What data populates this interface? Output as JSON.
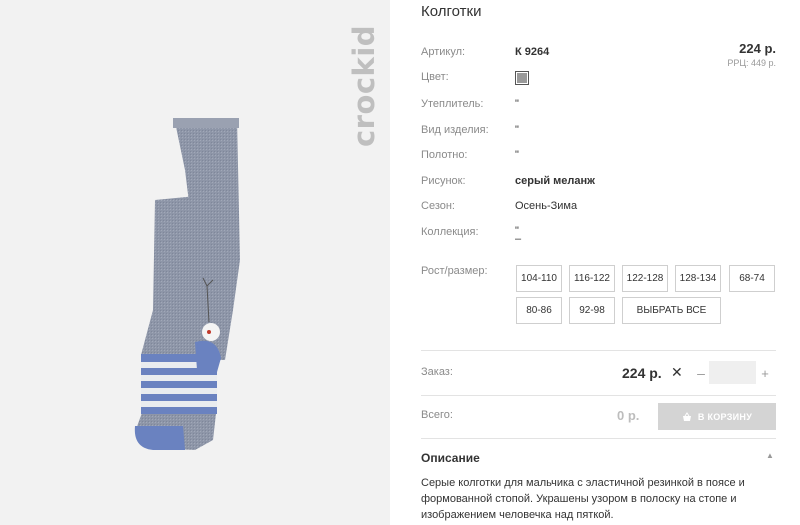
{
  "brand": {
    "logo_text": "crockid"
  },
  "product": {
    "title": "Колготки",
    "price": "224 р.",
    "rrp": "РРЦ: 449 р."
  },
  "attributes": {
    "article_label": "Артикул:",
    "article_value": "К 9264",
    "color_label": "Цвет:",
    "color_swatch": "#9a9a9a",
    "insulation_label": "Утеплитель:",
    "insulation_value": "\"",
    "type_label": "Вид изделия:",
    "type_value": "\"",
    "fabric_label": "Полотно:",
    "fabric_value": "\"",
    "pattern_label": "Рисунок:",
    "pattern_value": "серый меланж",
    "season_label": "Сезон:",
    "season_value": "Осень-Зима",
    "collection_label": "Коллекция:",
    "collection_value": "\"",
    "collection_value2": "–"
  },
  "sizes": {
    "label": "Рост/размер:",
    "options": [
      "104-110",
      "116-122",
      "122-128",
      "128-134",
      "68-74",
      "80-86",
      "92-98"
    ],
    "select_all": "ВЫБРАТЬ ВСЕ"
  },
  "order": {
    "label": "Заказ:",
    "price": "224 р.",
    "times": "✕",
    "minus": "–",
    "plus": "+",
    "quantity": ""
  },
  "total": {
    "label": "Всего:",
    "value": "0 р.",
    "cart_button": "В КОРЗИНУ"
  },
  "description": {
    "title": "Описание",
    "toggle": "▲",
    "text": "Серые колготки для мальчика с эластичной резинкой в поясе и формованной стопой. Украшены узором в полоску на стопе и изображением человечка над пяткой."
  },
  "colors": {
    "tights_gray": "#8e96a8",
    "stripe_blue": "#6a82c0",
    "stripe_white": "#e9ecef",
    "cart_button_bg": "#d4d4d4"
  }
}
